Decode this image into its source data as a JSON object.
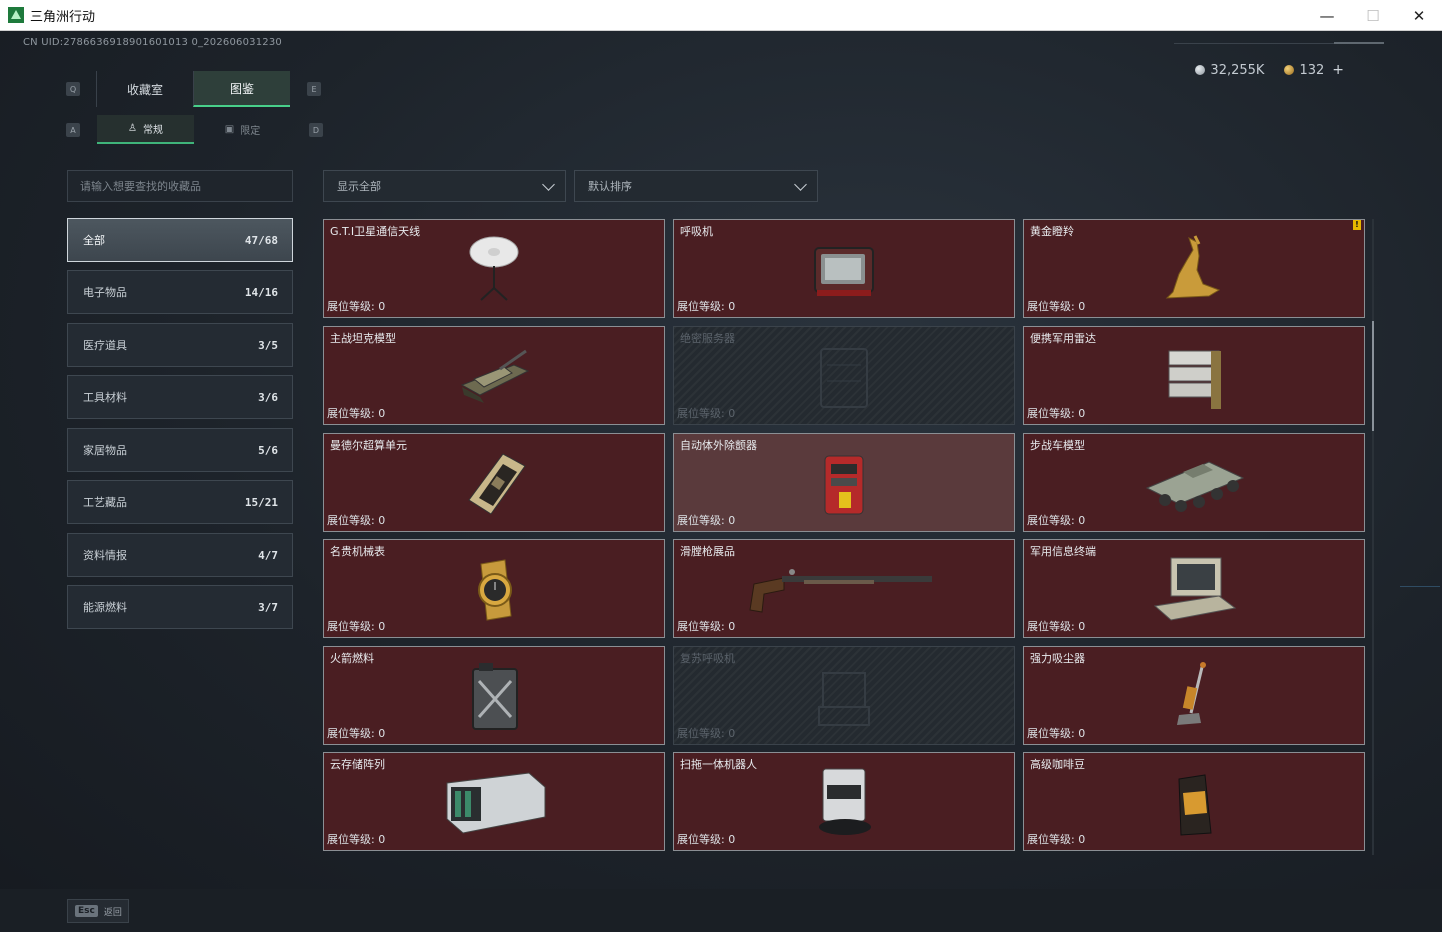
{
  "window": {
    "title": "三角洲行动",
    "minimize": "—",
    "maximize": "☐",
    "close": "✕"
  },
  "uid": "CN UID:2786636918901601013 0_202606031230",
  "currency": {
    "silver": "32,255K",
    "gold": "132",
    "plus": "+"
  },
  "keys": {
    "tab_left": "Q",
    "tab_right": "E",
    "sub_left": "A",
    "sub_right": "D"
  },
  "tabs": {
    "collection": "收藏室",
    "catalog": "图鉴"
  },
  "subtabs": {
    "normal": "常规",
    "limited": "限定"
  },
  "search": {
    "placeholder": "请输入想要查找的收藏品"
  },
  "filters": {
    "show": "显示全部",
    "sort": "默认排序"
  },
  "categories": [
    {
      "label": "全部",
      "count": "47/68"
    },
    {
      "label": "电子物品",
      "count": "14/16"
    },
    {
      "label": "医疗道具",
      "count": "3/5"
    },
    {
      "label": "工具材料",
      "count": "3/6"
    },
    {
      "label": "家居物品",
      "count": "5/6"
    },
    {
      "label": "工艺藏品",
      "count": "15/21"
    },
    {
      "label": "资料情报",
      "count": "4/7"
    },
    {
      "label": "能源燃料",
      "count": "3/7"
    }
  ],
  "level_label": "展位等级: 0",
  "items": [
    {
      "name": "G.T.I卫星通信天线",
      "art": "satellite-dish-icon"
    },
    {
      "name": "呼吸机",
      "art": "ventilator-icon"
    },
    {
      "name": "黄金瞪羚",
      "art": "golden-gazelle-icon",
      "badge": "!"
    },
    {
      "name": "主战坦克模型",
      "art": "tank-model-icon"
    },
    {
      "name": "绝密服务器",
      "art": "server-icon"
    },
    {
      "name": "便携军用雷达",
      "art": "radar-icon"
    },
    {
      "name": "曼德尔超算单元",
      "art": "supercomputer-unit-icon"
    },
    {
      "name": "自动体外除颤器",
      "art": "defibrillator-icon"
    },
    {
      "name": "步战车模型",
      "art": "ifv-model-icon"
    },
    {
      "name": "名贵机械表",
      "art": "watch-icon"
    },
    {
      "name": "滑膛枪展品",
      "art": "musket-icon"
    },
    {
      "name": "军用信息终端",
      "art": "terminal-icon"
    },
    {
      "name": "火箭燃料",
      "art": "fuel-can-icon"
    },
    {
      "name": "复苏呼吸机",
      "art": "resuscitator-icon"
    },
    {
      "name": "强力吸尘器",
      "art": "vacuum-icon"
    },
    {
      "name": "云存储阵列",
      "art": "storage-array-icon"
    },
    {
      "name": "扫拖一体机器人",
      "art": "robot-vacuum-icon"
    },
    {
      "name": "高级咖啡豆",
      "art": "coffee-bag-icon"
    }
  ],
  "bottom": {
    "esc_key": "Esc",
    "esc_label": "返回"
  }
}
